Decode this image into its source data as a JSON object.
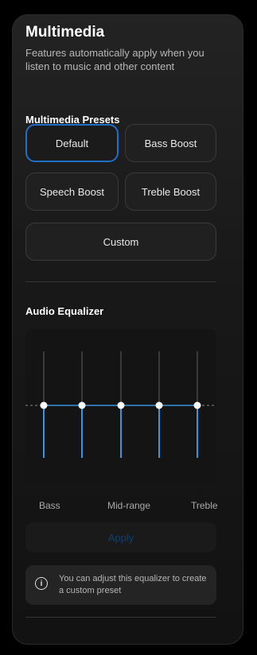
{
  "header": {
    "title": "Multimedia",
    "subtitle": "Features automatically apply when you listen to music and other content"
  },
  "presets": {
    "heading": "Multimedia Presets",
    "selected": "Default",
    "items": [
      {
        "label": "Default"
      },
      {
        "label": "Bass Boost"
      },
      {
        "label": "Speech Boost"
      },
      {
        "label": "Treble Boost"
      },
      {
        "label": "Custom"
      }
    ]
  },
  "equalizer": {
    "heading": "Audio Equalizer",
    "band_levels": [
      0,
      0,
      0,
      0,
      0
    ],
    "labels": {
      "left": "Bass",
      "middle": "Mid-range",
      "right": "Treble"
    },
    "accent_color": "#3a94e0"
  },
  "apply_label": "Apply",
  "info": {
    "icon": "info-icon",
    "text": "You can adjust this equalizer to create a custom preset"
  }
}
